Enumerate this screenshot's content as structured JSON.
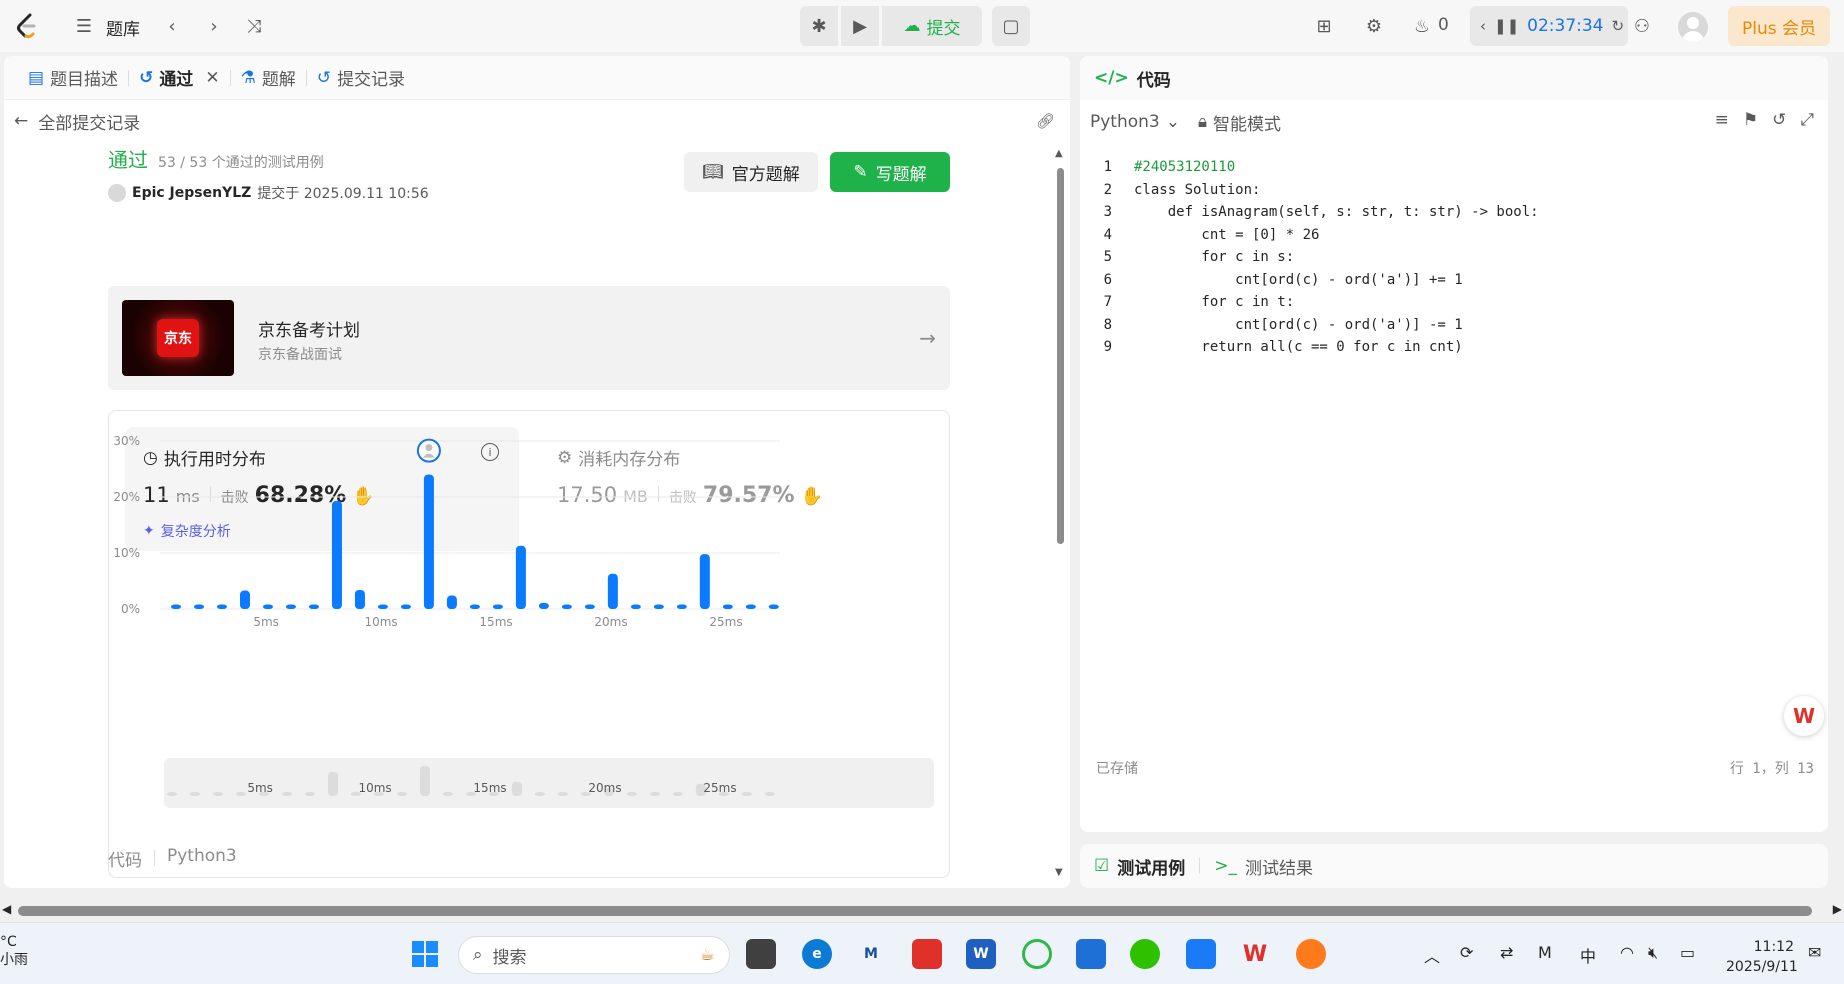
{
  "topbar": {
    "problem_list_label": "题库",
    "submit_label": "提交",
    "streak_count": "0",
    "timer": "02:37:34",
    "plus_label": "Plus 会员"
  },
  "left": {
    "tabs": [
      {
        "label": "题目描述",
        "icon": "doc-icon"
      },
      {
        "label": "通过",
        "icon": "history-icon"
      },
      {
        "label": "题解",
        "icon": "flask-icon"
      },
      {
        "label": "提交记录",
        "icon": "history-icon"
      }
    ],
    "back_label": "全部提交记录",
    "status": "通过",
    "cases": "53 / 53 个通过的测试用例",
    "author": "Epic JepsenYLZ",
    "submitted_at": "提交于 2025.09.11 10:56",
    "official_solution_label": "官方题解",
    "write_solution_label": "写题解",
    "promo": {
      "logo_text": "京东",
      "title": "京东备考计划",
      "subtitle": "京东备战面试"
    },
    "runtime": {
      "title": "执行用时分布",
      "value": "11",
      "unit": "ms",
      "beat_label": "击败",
      "percent": "68.28%",
      "complexity_label": "复杂度分析"
    },
    "memory": {
      "title": "消耗内存分布",
      "value": "17.50",
      "unit": "MB",
      "beat_label": "击败",
      "percent": "79.57%"
    },
    "code_label": "代码",
    "code_lang": "Python3"
  },
  "chart_data": {
    "type": "bar",
    "ylabel": "",
    "xlabel": "",
    "ylim": [
      0,
      30
    ],
    "y_ticks": [
      "30%",
      "20%",
      "10%",
      "0%"
    ],
    "x_ticks": [
      "5ms",
      "10ms",
      "15ms",
      "20ms",
      "25ms"
    ],
    "categories": [
      1,
      2,
      3,
      4,
      5,
      6,
      7,
      8,
      9,
      10,
      11,
      12,
      13,
      14,
      15,
      16,
      17,
      18,
      19,
      20,
      21,
      22,
      23,
      24,
      25,
      26,
      27
    ],
    "values": [
      0.8,
      0.8,
      0.8,
      3.3,
      0.8,
      0.8,
      0.8,
      19.3,
      3.4,
      0.8,
      0.8,
      24.0,
      2.4,
      0.8,
      0.8,
      11.3,
      1.1,
      0.8,
      0.8,
      6.3,
      0.8,
      0.8,
      0.8,
      9.8,
      0.8,
      0.8,
      0.8
    ],
    "user_bar_index": 11,
    "color": "#0a7aff",
    "grid": true
  },
  "right": {
    "title": "代码",
    "language": "Python3",
    "mode": "智能模式",
    "code_lines": [
      "#24053120110",
      "class Solution:",
      "    def isAnagram(self, s: str, t: str) -> bool:",
      "        cnt = [0] * 26",
      "        for c in s:",
      "            cnt[ord(c) - ord('a')] += 1",
      "        for c in t:",
      "            cnt[ord(c) - ord('a')] -= 1",
      "        return all(c == 0 for c in cnt)"
    ],
    "saved_label": "已存储",
    "cursor_pos": "行 1，列 13",
    "test_case_label": "测试用例",
    "test_result_label": "测试结果"
  },
  "taskbar": {
    "weather_temp": "°C",
    "weather_desc": "小雨",
    "search_placeholder": "搜索",
    "ime": "中",
    "time": "11:12",
    "date": "2025/9/11"
  }
}
